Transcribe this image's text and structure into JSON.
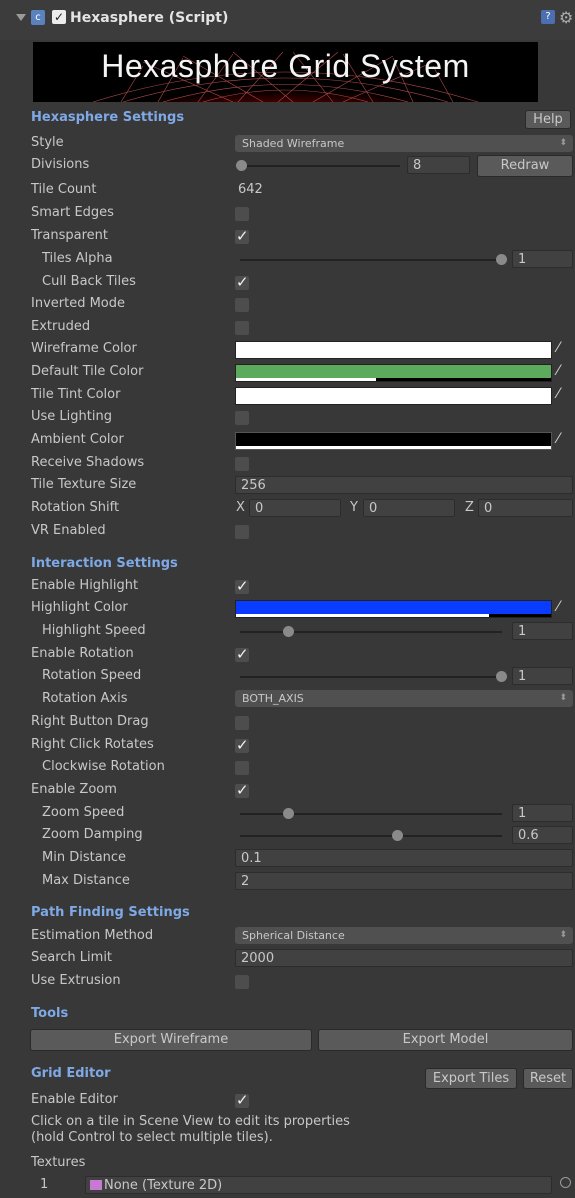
{
  "header": {
    "title": "Hexasphere (Script)",
    "enabled": true
  },
  "banner": {
    "title": "Hexasphere Grid System"
  },
  "hexasphere_settings": {
    "section": "Hexasphere Settings",
    "help_button": "Help",
    "style": {
      "label": "Style",
      "value": "Shaded Wireframe"
    },
    "divisions": {
      "label": "Divisions",
      "value": "8",
      "redraw": "Redraw"
    },
    "tile_count": {
      "label": "Tile Count",
      "value": "642"
    },
    "smart_edges": {
      "label": "Smart Edges",
      "checked": false
    },
    "transparent": {
      "label": "Transparent",
      "checked": true
    },
    "tiles_alpha": {
      "label": "Tiles Alpha",
      "value": "1"
    },
    "cull_back_tiles": {
      "label": "Cull Back Tiles",
      "checked": true
    },
    "inverted_mode": {
      "label": "Inverted Mode",
      "checked": false
    },
    "extruded": {
      "label": "Extruded",
      "checked": false
    },
    "wireframe_color": {
      "label": "Wireframe Color",
      "color": "#ffffff"
    },
    "default_tile_color": {
      "label": "Default Tile Color",
      "color": "#5caa5c"
    },
    "tile_tint_color": {
      "label": "Tile Tint Color",
      "color": "#ffffff"
    },
    "use_lighting": {
      "label": "Use Lighting",
      "checked": false
    },
    "ambient_color": {
      "label": "Ambient Color",
      "color": "#000000"
    },
    "receive_shadows": {
      "label": "Receive Shadows",
      "checked": false
    },
    "tile_texture_size": {
      "label": "Tile Texture Size",
      "value": "256"
    },
    "rotation_shift": {
      "label": "Rotation Shift",
      "x_label": "X",
      "x": "0",
      "y_label": "Y",
      "y": "0",
      "z_label": "Z",
      "z": "0"
    },
    "vr_enabled": {
      "label": "VR Enabled",
      "checked": false
    }
  },
  "interaction_settings": {
    "section": "Interaction Settings",
    "enable_highlight": {
      "label": "Enable Highlight",
      "checked": true
    },
    "highlight_color": {
      "label": "Highlight Color",
      "color": "#0a3cff"
    },
    "highlight_speed": {
      "label": "Highlight Speed",
      "value": "1"
    },
    "enable_rotation": {
      "label": "Enable Rotation",
      "checked": true
    },
    "rotation_speed": {
      "label": "Rotation Speed",
      "value": "1"
    },
    "rotation_axis": {
      "label": "Rotation Axis",
      "value": "BOTH_AXIS"
    },
    "right_button_drag": {
      "label": "Right Button Drag",
      "checked": false
    },
    "right_click_rotates": {
      "label": "Right Click Rotates",
      "checked": true
    },
    "clockwise_rotation": {
      "label": "Clockwise Rotation",
      "checked": false
    },
    "enable_zoom": {
      "label": "Enable Zoom",
      "checked": true
    },
    "zoom_speed": {
      "label": "Zoom Speed",
      "value": "1"
    },
    "zoom_damping": {
      "label": "Zoom Damping",
      "value": "0.6"
    },
    "min_distance": {
      "label": "Min Distance",
      "value": "0.1"
    },
    "max_distance": {
      "label": "Max Distance",
      "value": "2"
    }
  },
  "path_finding": {
    "section": "Path Finding Settings",
    "estimation_method": {
      "label": "Estimation Method",
      "value": "Spherical Distance"
    },
    "search_limit": {
      "label": "Search Limit",
      "value": "2000"
    },
    "use_extrusion": {
      "label": "Use Extrusion",
      "checked": false
    }
  },
  "tools": {
    "section": "Tools",
    "export_wireframe": "Export Wireframe",
    "export_model": "Export Model"
  },
  "grid_editor": {
    "section": "Grid Editor",
    "export_tiles": "Export Tiles",
    "reset": "Reset",
    "enable_editor": {
      "label": "Enable Editor",
      "checked": true
    },
    "note_line1": "Click on a tile in Scene View to edit its properties",
    "note_line2": "(hold Control to select multiple tiles).",
    "textures_label": "Textures",
    "texture_index": "1",
    "texture_value": "None (Texture 2D)"
  }
}
